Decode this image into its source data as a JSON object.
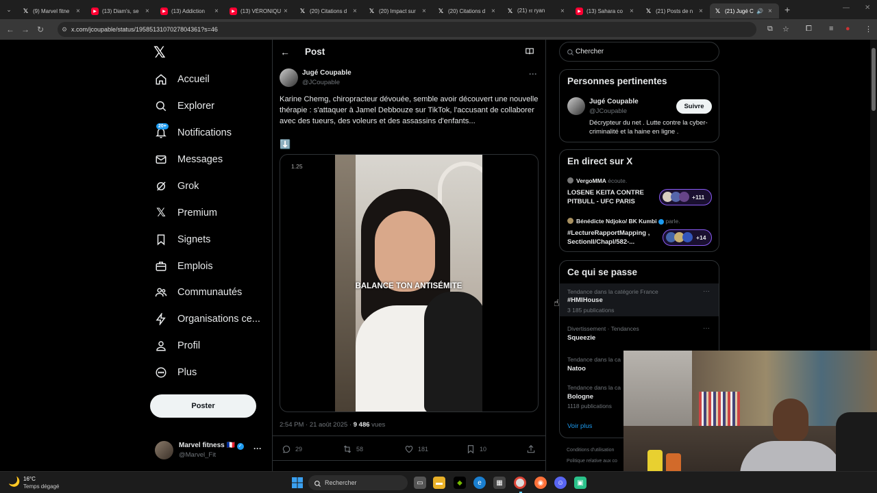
{
  "browser": {
    "tabs": [
      {
        "title": "(9) Marvel fitne",
        "favicon": "x"
      },
      {
        "title": "(13) Diam's, se",
        "favicon": "yt"
      },
      {
        "title": "(13) Addiction",
        "favicon": "yt"
      },
      {
        "title": "(13) VÉRONIQU",
        "favicon": "yt"
      },
      {
        "title": "(20) Citations d",
        "favicon": "x"
      },
      {
        "title": "(20) Impact sur",
        "favicon": "x"
      },
      {
        "title": "(20) Citations d",
        "favicon": "x"
      },
      {
        "title": "(21) 𝔵𝔯 ryan",
        "favicon": "x"
      },
      {
        "title": "(13) Sahara co",
        "favicon": "yt"
      },
      {
        "title": "(21) Posts de n",
        "favicon": "x"
      },
      {
        "title": "(21) Jugé C",
        "favicon": "x"
      }
    ],
    "url": "x.com/jcoupable/status/1958513107027804361?s=46"
  },
  "sidebar": {
    "items": [
      {
        "label": "Accueil",
        "icon": "home-icon"
      },
      {
        "label": "Explorer",
        "icon": "search-icon"
      },
      {
        "label": "Notifications",
        "icon": "bell-icon",
        "badge": "20+"
      },
      {
        "label": "Messages",
        "icon": "mail-icon"
      },
      {
        "label": "Grok",
        "icon": "grok-icon"
      },
      {
        "label": "Premium",
        "icon": "x-premium-icon"
      },
      {
        "label": "Signets",
        "icon": "bookmark-icon"
      },
      {
        "label": "Emplois",
        "icon": "briefcase-icon"
      },
      {
        "label": "Communautés",
        "icon": "people-icon"
      },
      {
        "label": "Organisations ce...",
        "icon": "lightning-icon"
      },
      {
        "label": "Profil",
        "icon": "person-icon"
      },
      {
        "label": "Plus",
        "icon": "more-circle-icon"
      }
    ],
    "post_button": "Poster",
    "account": {
      "name": "Marvel fitness",
      "flag": "🇫🇷",
      "handle": "@Marvel_Fit",
      "more": "···"
    }
  },
  "post": {
    "header_title": "Post",
    "author_name": "Jugé Coupable",
    "author_handle": "@JCoupable",
    "more": "···",
    "text": "Karine Chemg, chiropracteur dévouée, semble avoir découvert une nouvelle thérapie : s'attaquer à Jamel Debbouze sur TikTok, l'accusant de collaborer avec des tueurs, des voleurs et des assassins d'enfants...",
    "emoji": "⬇️",
    "video_timestamp": "1.25",
    "video_caption": "BALANCE TON ANTISÉMITE",
    "meta_time": "2:54 PM · 21 août 2025 · ",
    "views_count": "9 486",
    "views_label": " vues",
    "replies": "29",
    "reposts": "58",
    "likes": "181",
    "bookmarks": "10"
  },
  "right": {
    "search_placeholder": "Chercher",
    "relevant": {
      "title": "Personnes pertinentes",
      "name": "Jugé Coupable",
      "handle": "@JCoupable",
      "follow": "Suivre",
      "bio": "Décrypteur du net . Lutte contre la cyber-criminalité et la haine en ligne ."
    },
    "live": {
      "title": "En direct sur X",
      "items": [
        {
          "host": "VergoMMA",
          "status": "écoute.",
          "title": "LOSENE KEITA CONTRE PITBULL - UFC PARIS",
          "count": "+111"
        },
        {
          "host": "Bénédicte Ndjoko/ BK Kumbi",
          "status": "parle.",
          "title": "#LectureRapportMapping , SectionII/Chapl/582-...",
          "count": "+14"
        }
      ]
    },
    "trends": {
      "title": "Ce qui se passe",
      "items": [
        {
          "context": "Tendance dans la catégorie France",
          "name": "#HMIHouse",
          "count": "3 185 publications"
        },
        {
          "context": "Divertissement · Tendances",
          "name": "Squeezie",
          "count": ""
        },
        {
          "context": "Tendance dans la ca",
          "name": "Natoo",
          "count": ""
        },
        {
          "context": "Tendance dans la ca",
          "name": "Bologne",
          "count": "1118 publications"
        }
      ],
      "more_link": "Voir plus"
    },
    "footer": [
      "Conditions d'utilisation",
      "Politique relative aux co"
    ]
  },
  "taskbar": {
    "weather_temp": "16°C",
    "weather_desc": "Temps dégagé",
    "search_placeholder": "Rechercher"
  },
  "colors": {
    "accent": "#1d9bf0",
    "background": "#000000",
    "border": "#2f3336",
    "dim_text": "#71767b"
  }
}
